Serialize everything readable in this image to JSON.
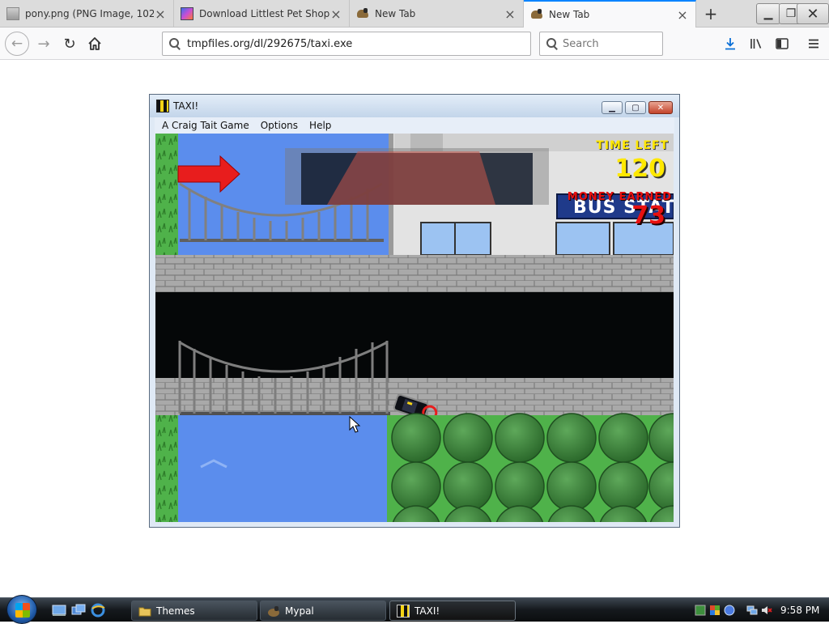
{
  "browser": {
    "tabs": [
      {
        "title": "pony.png (PNG Image, 1024 × 76",
        "icon": "image-file-icon",
        "active": false
      },
      {
        "title": "Download Littlest Pet Shop (W",
        "icon": "littlest-pet-shop-icon",
        "active": false
      },
      {
        "title": "New Tab",
        "icon": "pony-favicon-icon",
        "active": false
      },
      {
        "title": "New Tab",
        "icon": "pony-favicon-icon",
        "active": true
      }
    ],
    "url": "tmpfiles.org/dl/292675/taxi.exe",
    "search_placeholder": "Search"
  },
  "app": {
    "title": "TAXI!",
    "menu": [
      "A Craig Tait Game",
      "Options",
      "Help"
    ],
    "hud": {
      "time_left_label": "TIME LEFT",
      "time_left_value": "120",
      "money_label": "MONEY EARNED",
      "money_value": "73"
    },
    "sign_text": "BUS STATI"
  },
  "taskbar": {
    "items": [
      {
        "label": "Themes",
        "icon": "folder-icon",
        "active": false
      },
      {
        "label": "Mypal",
        "icon": "mypal-browser-icon",
        "active": false
      },
      {
        "label": "TAXI!",
        "icon": "taxi-icon",
        "active": true
      }
    ],
    "clock": "9:58 PM"
  },
  "colors": {
    "tab_accent": "#0a84ff",
    "water": "#5b8ded",
    "grass": "#4fb24a",
    "road": "#050708",
    "hud_yellow": "#ffe800",
    "hud_red": "#e81010"
  }
}
